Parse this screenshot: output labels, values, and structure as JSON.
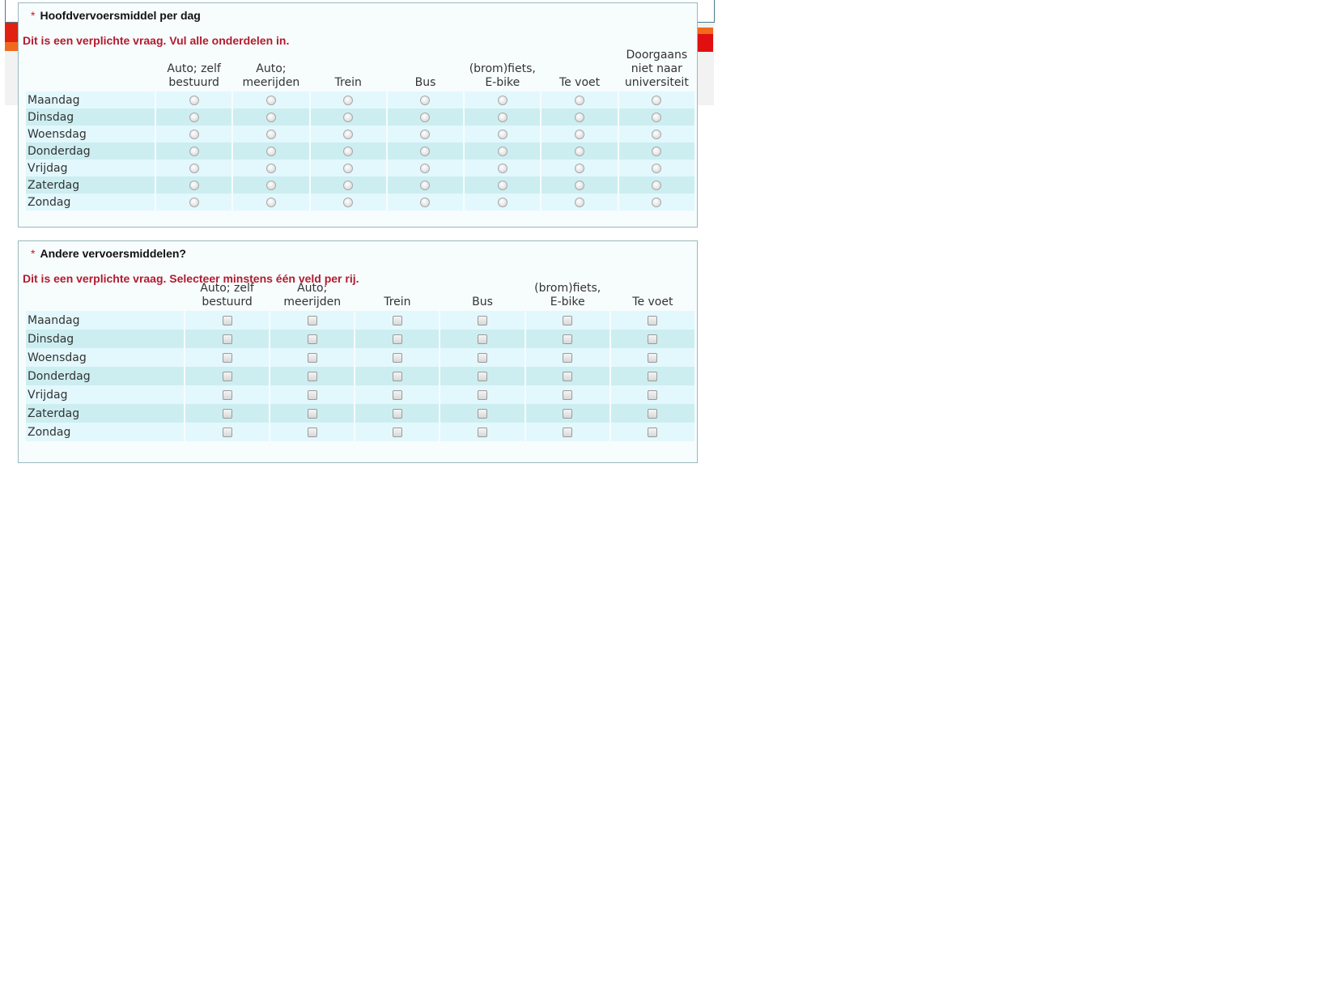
{
  "questions": [
    {
      "asterisk": "*",
      "title": "Hoofdvervoersmiddel per dag",
      "error": "Dit is een verplichte vraag. Vul alle onderdelen in.",
      "input_type": "radio",
      "columns": [
        [
          "Auto; zelf",
          "bestuurd"
        ],
        [
          "Auto;",
          "meerijden"
        ],
        [
          "Trein"
        ],
        [
          "Bus"
        ],
        [
          "(brom)fiets,",
          "E-bike"
        ],
        [
          "Te voet"
        ],
        [
          "Doorgaans",
          "niet naar",
          "universiteit"
        ]
      ],
      "rows": [
        "Maandag",
        "Dinsdag",
        "Woensdag",
        "Donderdag",
        "Vrijdag",
        "Zaterdag",
        "Zondag"
      ]
    },
    {
      "asterisk": "*",
      "title": "Andere vervoersmiddelen?",
      "error": "Dit is een verplichte vraag. Selecteer minstens één veld per rij.",
      "input_type": "checkbox",
      "columns": [
        [
          "Auto; zelf",
          "bestuurd"
        ],
        [
          "Auto;",
          "meerijden"
        ],
        [
          "Trein"
        ],
        [
          "Bus"
        ],
        [
          "(brom)fiets,",
          "E-bike"
        ],
        [
          "Te voet"
        ]
      ],
      "rows": [
        "Maandag",
        "Dinsdag",
        "Woensdag",
        "Donderdag",
        "Vrijdag",
        "Zaterdag",
        "Zondag"
      ]
    }
  ],
  "colors": {
    "error_text": "#b31b2e",
    "row_light": "#e3f8fd",
    "row_dark": "#cdeef1",
    "panel_border": "#9ab8bd"
  }
}
